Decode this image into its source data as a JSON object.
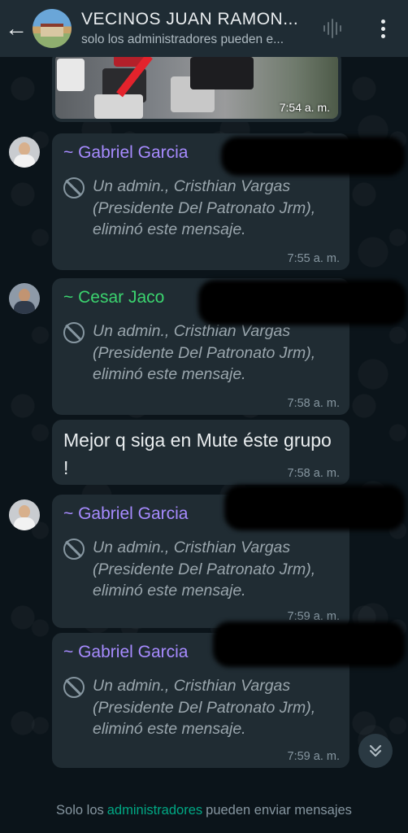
{
  "header": {
    "title": "VECINOS JUAN RAMON...",
    "subtitle": "solo los administradores pueden e...",
    "icons": [
      "back-arrow-icon",
      "voice-call-icon",
      "more-vert-icon"
    ]
  },
  "image_message": {
    "time": "7:54 a. m."
  },
  "deleted_template": "Un admin., Cristhian Vargas (Presidente Del Patronato Jrm), eliminó este mensaje.",
  "messages": [
    {
      "sender": "~ Gabriel Garcia",
      "text": "Un admin., Cristhian Vargas (Presidente Del Patronato Jrm), eliminó este mensaje.",
      "time": "7:55 a. m."
    },
    {
      "sender": "~ Cesar Jaco",
      "text": "Un admin., Cristhian Vargas (Presidente Del Patronato Jrm), eliminó este mensaje.",
      "time": "7:58 a. m."
    },
    {
      "sender": "",
      "text": "Mejor q siga en Mute éste grupo !",
      "time": "7:58 a. m."
    },
    {
      "sender": "~ Gabriel Garcia",
      "text": "Un admin., Cristhian Vargas (Presidente Del Patronato Jrm), eliminó este mensaje.",
      "time": "7:59 a. m."
    },
    {
      "sender": "~ Gabriel Garcia",
      "text": "Un admin., Cristhian Vargas (Presidente Del Patronato Jrm), eliminó este mensaje.",
      "time": "7:59 a. m."
    }
  ],
  "footer": {
    "prefix": "Solo los",
    "accent": "administradores",
    "suffix": "pueden enviar mensajes"
  },
  "colors": {
    "header_bg": "#1f2c34",
    "bubble_bg": "#202c33",
    "sender_purple": "#a78bff",
    "sender_green": "#3bd46f",
    "accent": "#00a884"
  }
}
